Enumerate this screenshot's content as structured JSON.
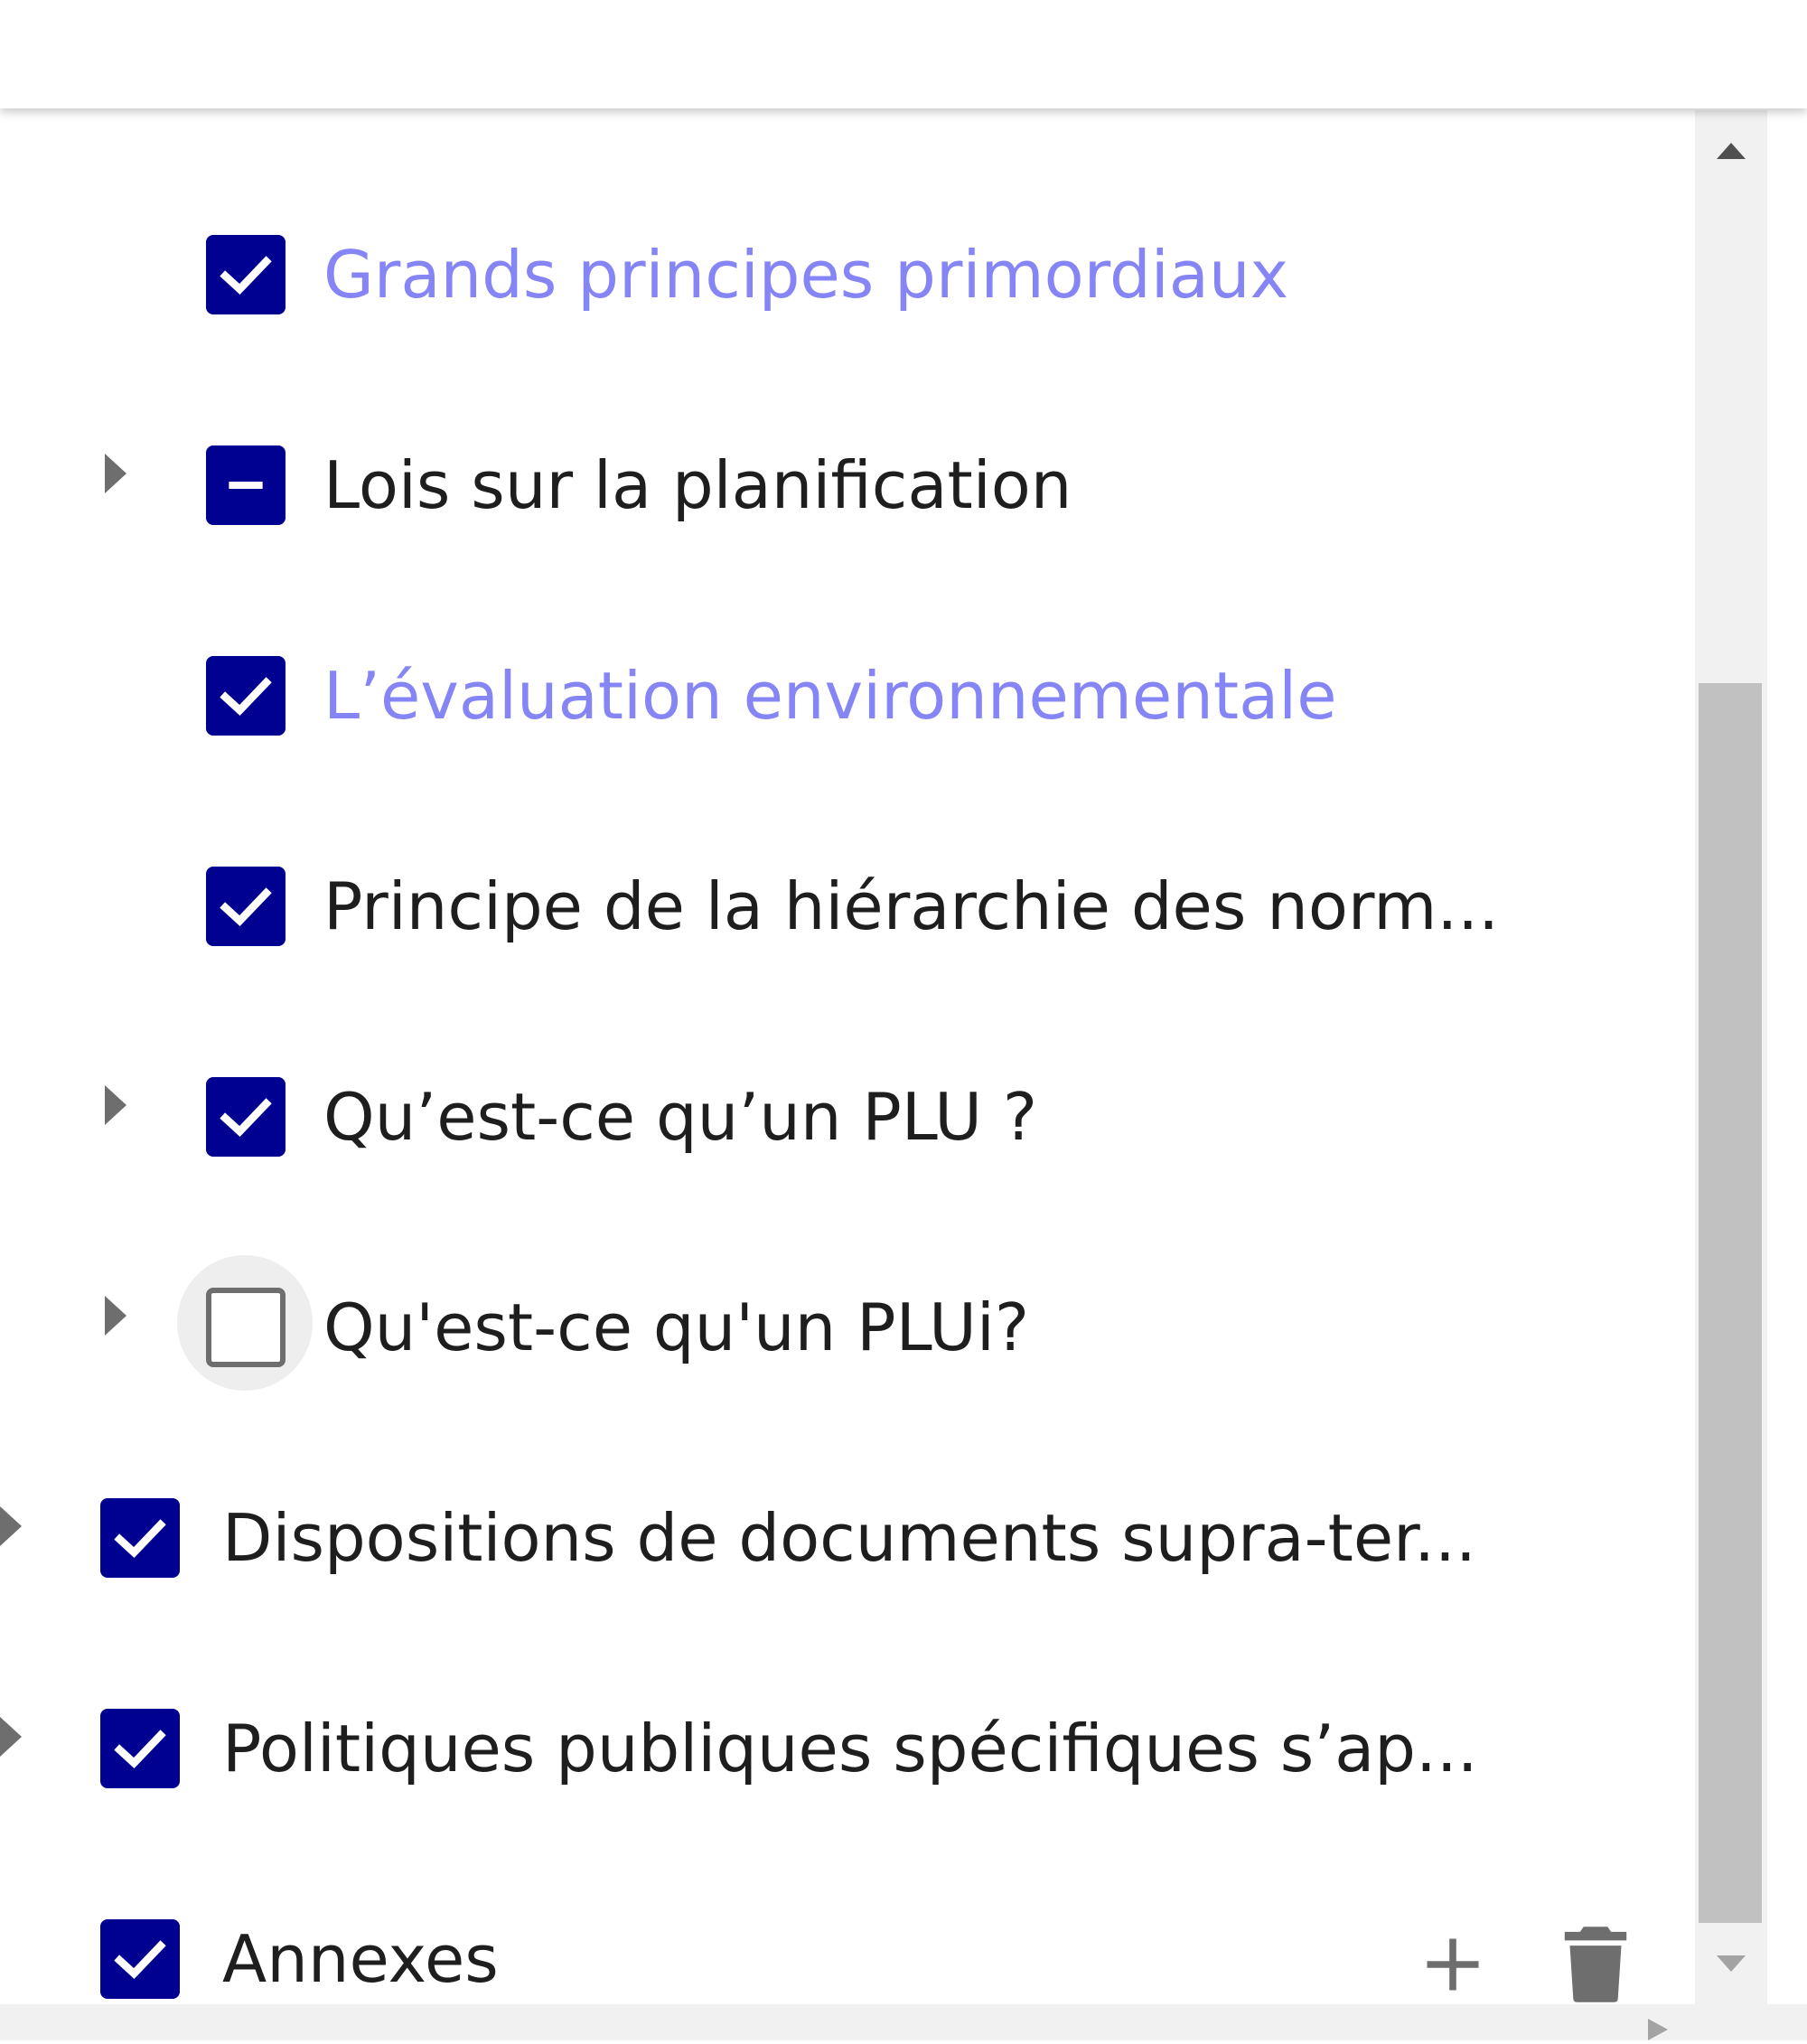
{
  "colors": {
    "checkbox_checked": "#000091",
    "label_default": "#1e1e1e",
    "label_muted": "#8585f6",
    "icon_gray": "#6e6e6e",
    "scrollbar_track": "#f1f1f1",
    "scrollbar_thumb": "#c1c1c1"
  },
  "tree": {
    "items": [
      {
        "label": "Grands principes primordiaux",
        "state": "checked",
        "expandable": false,
        "muted": true,
        "level": 2
      },
      {
        "label": "Lois sur la planification",
        "state": "indeterminate",
        "expandable": true,
        "muted": false,
        "level": 2
      },
      {
        "label": "L’évaluation environnementale",
        "state": "checked",
        "expandable": false,
        "muted": true,
        "level": 2
      },
      {
        "label": "Principe de la hiérarchie des norm...",
        "state": "checked",
        "expandable": false,
        "muted": false,
        "level": 2
      },
      {
        "label": "Qu’est-ce qu’un PLU ?",
        "state": "checked",
        "expandable": true,
        "muted": false,
        "level": 2
      },
      {
        "label": "Qu'est-ce qu'un PLUi?",
        "state": "unchecked",
        "expandable": true,
        "muted": false,
        "level": 2,
        "focused": true
      },
      {
        "label": "Dispositions de documents supra-ter...",
        "state": "checked",
        "expandable": true,
        "muted": false,
        "level": 1
      },
      {
        "label": "Politiques publiques spécifiques s’ap...",
        "state": "checked",
        "expandable": true,
        "muted": false,
        "level": 1
      },
      {
        "label": "Annexes",
        "state": "checked",
        "expandable": false,
        "muted": false,
        "level": 1,
        "hovered": true
      }
    ],
    "row_actions": {
      "add_icon": "plus-icon",
      "delete_icon": "trash-icon"
    }
  },
  "scrollbar": {
    "vertical_position": 0.85,
    "up_icon": "triangle-up-icon",
    "down_icon": "triangle-down-icon",
    "right_icon": "triangle-right-icon"
  }
}
